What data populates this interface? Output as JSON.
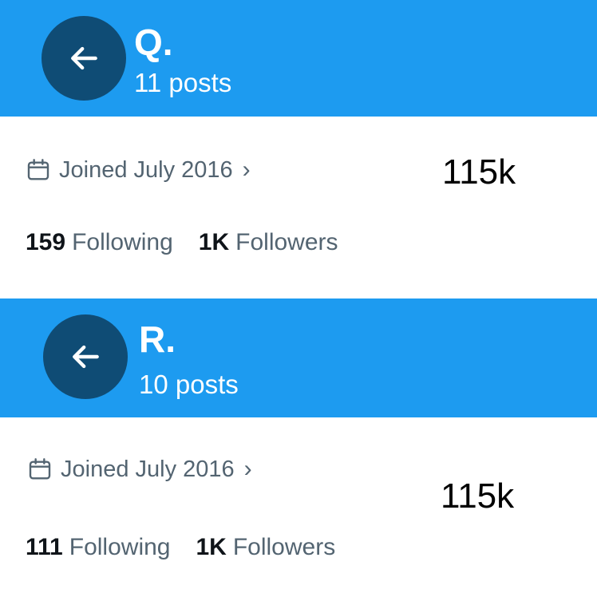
{
  "accent_color": "#1d9bf0",
  "back_button_color": "#0f4c75",
  "profiles": [
    {
      "name": "Q.",
      "posts": "11 posts",
      "back_icon": "arrow-left-icon",
      "calendar_icon": "calendar-icon",
      "joined": "Joined July 2016",
      "joined_chevron": "›",
      "following_count": "159",
      "following_label": "Following",
      "followers_count": "1K",
      "followers_label": "Followers",
      "overlay_count": "115k"
    },
    {
      "name": "R.",
      "posts": "10 posts",
      "back_icon": "arrow-left-icon",
      "calendar_icon": "calendar-icon",
      "joined": "Joined July 2016",
      "joined_chevron": "›",
      "following_count": "111",
      "following_label": "Following",
      "followers_count": "1K",
      "followers_label": "Followers",
      "overlay_count": "115k"
    }
  ]
}
